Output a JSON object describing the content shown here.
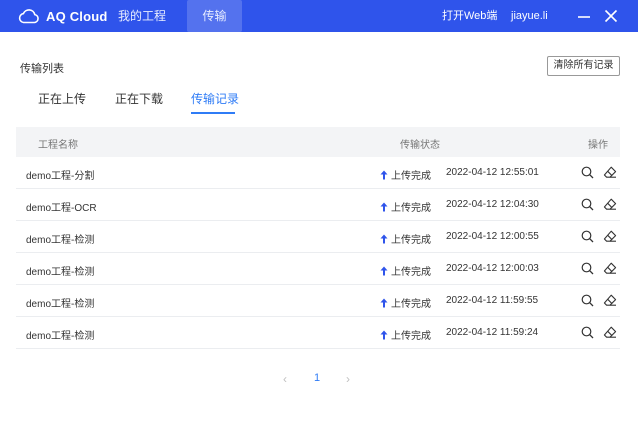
{
  "header": {
    "app_name": "AQ Cloud",
    "nav": [
      {
        "label": "我的工程"
      },
      {
        "label": "传输",
        "active": true
      }
    ],
    "open_web_label": "打开Web端",
    "username": "jiayue.li",
    "accent": "#2f54eb"
  },
  "transfer": {
    "title": "传输列表",
    "clear_button": "清除所有记录",
    "tabs": [
      {
        "label": "正在上传"
      },
      {
        "label": "正在下载"
      },
      {
        "label": "传输记录",
        "active": true
      }
    ]
  },
  "table": {
    "columns": [
      "工程名称",
      "传输状态",
      "操作"
    ],
    "rows": [
      {
        "name": "demo工程-分割",
        "status": "上传完成",
        "time": "2022-04-12 12:55:01"
      },
      {
        "name": "demo工程-OCR",
        "status": "上传完成",
        "time": "2022-04-12 12:04:30"
      },
      {
        "name": "demo工程-检测",
        "status": "上传完成",
        "time": "2022-04-12 12:00:55"
      },
      {
        "name": "demo工程-检测",
        "status": "上传完成",
        "time": "2022-04-12 12:00:03"
      },
      {
        "name": "demo工程-检测",
        "status": "上传完成",
        "time": "2022-04-12 11:59:55"
      },
      {
        "name": "demo工程-检测",
        "status": "上传完成",
        "time": "2022-04-12 11:59:24"
      }
    ]
  },
  "pagination": {
    "current_page": "1",
    "prev_glyph": "‹",
    "next_glyph": "›"
  }
}
